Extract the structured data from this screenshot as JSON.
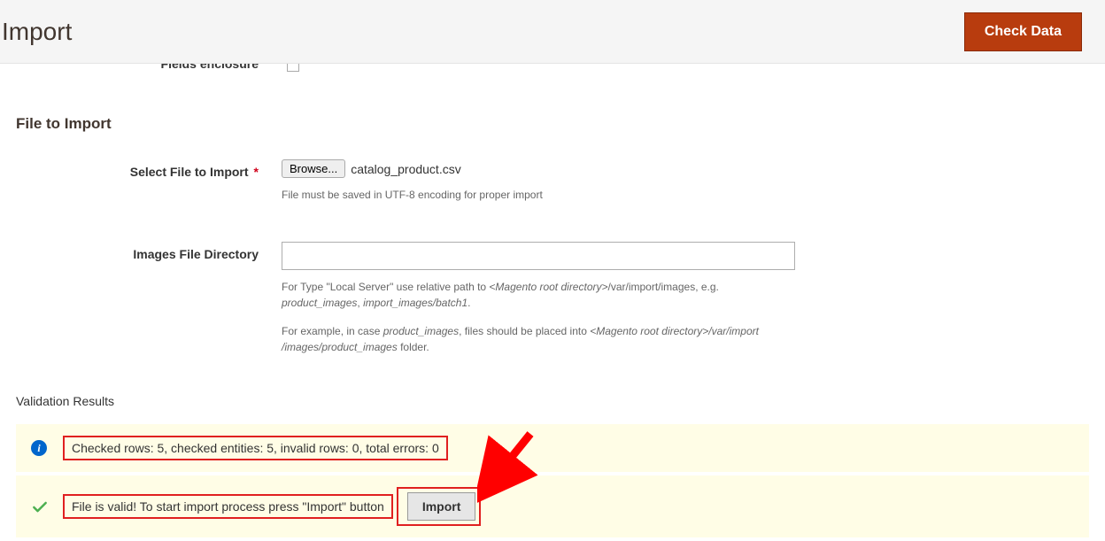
{
  "header": {
    "title": "Import",
    "check_data_label": "Check Data"
  },
  "partial": {
    "fields_enclosure_label": "Fields enclosure"
  },
  "file_section": {
    "title": "File to Import",
    "select_label": "Select File to Import",
    "browse_label": "Browse...",
    "file_name": "catalog_product.csv",
    "file_help": "File must be saved in UTF-8 encoding for proper import",
    "images_dir_label": "Images File Directory",
    "images_dir_value": "",
    "images_help_1a": "For Type \"Local Server\" use relative path to ",
    "images_help_1b": "<Magento root directory>",
    "images_help_1c": "/var/import/images, e.g. ",
    "images_help_1d": "product_images",
    "images_help_1e": ", ",
    "images_help_1f": "import_images/batch1",
    "images_help_1g": ".",
    "images_help_2a": "For example, in case ",
    "images_help_2b": "product_images",
    "images_help_2c": ", files should be placed into ",
    "images_help_2d": "<Magento root directory>/var/import",
    "images_help_2e": "/images/product_images",
    "images_help_2f": " folder."
  },
  "validation": {
    "title": "Validation Results",
    "info_msg": "Checked rows: 5, checked entities: 5, invalid rows: 0, total errors: 0",
    "success_msg": "File is valid! To start import process press \"Import\" button",
    "import_label": "Import"
  }
}
